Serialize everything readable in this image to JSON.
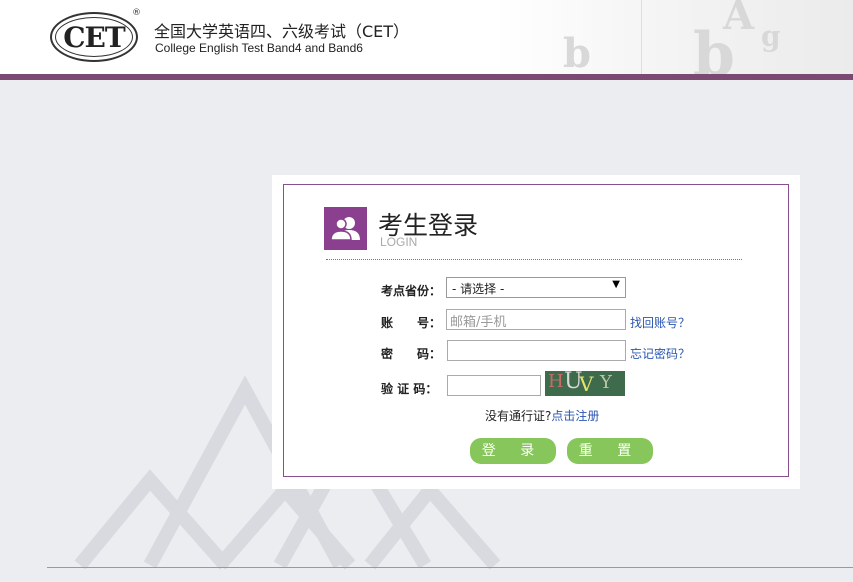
{
  "header": {
    "logo_text": "CET",
    "registered_mark": "®",
    "title_cn": "全国大学英语四、六级考试（CET）",
    "title_en": "College English Test Band4 and Band6"
  },
  "login": {
    "title": "考生登录",
    "subtitle": "LOGIN",
    "province_label": "考点省份：",
    "province_selected": "- 请选择 -",
    "account_label": "账　　号：",
    "account_placeholder": "邮箱/手机",
    "find_account_link": "找回账号？",
    "password_label": "密　　码：",
    "forgot_password_link": "忘记密码？",
    "captcha_label": "验 证 码：",
    "captcha_chars": [
      "H",
      "U",
      "V",
      "Y"
    ],
    "no_pass_text": "没有通行证?",
    "register_link": "点击注册",
    "login_button": "登 录",
    "reset_button": "重 置"
  },
  "colors": {
    "brand_purple": "#8b3f8f",
    "header_bar": "#7a4a73",
    "button_green": "#86c65a",
    "link_blue": "#2a55b0",
    "page_bg": "#ecedf1"
  },
  "icons": {
    "login": "users-icon",
    "select_arrow": "caret-down-icon"
  }
}
